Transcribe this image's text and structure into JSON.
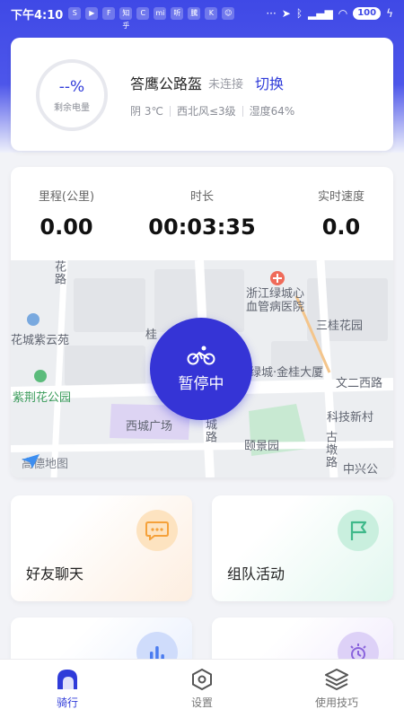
{
  "status_bar": {
    "time": "下午4:10",
    "apps": [
      "S",
      "▶",
      "F",
      "知乎",
      "C",
      "mi",
      "听",
      "騰",
      "K",
      "☺"
    ],
    "more": "···",
    "battery": "100"
  },
  "device": {
    "battery_value": "--%",
    "battery_label": "剩余电量",
    "name": "答鹰公路盔",
    "status": "未连接",
    "switch_label": "切换",
    "weather": {
      "condition": "阴 3℃",
      "wind": "西北风≤3级",
      "humidity": "湿度64%"
    }
  },
  "stats": {
    "distance_label": "里程(公里)",
    "distance_value": "0.00",
    "duration_label": "时长",
    "duration_value": "00:03:35",
    "speed_label": "实时速度",
    "speed_value": "0.0"
  },
  "map": {
    "labels": {
      "huajiao_road": "花路",
      "huacheng_ziyun": "花城紫云苑",
      "zijinghua_park": "紫荆花公园",
      "hospital": "浙江绿城心血管病医院",
      "sanguihuayuan": "三桂花园",
      "guihuayuan_partial": "桂",
      "jinguidasha": "绿城·金桂大厦",
      "wener_west_road": "文二西路",
      "tech_village": "科技新村",
      "xicheng_square": "西城广场",
      "chengroad": "城路",
      "yijingyuan": "颐景园",
      "gudun_road": "古墩路",
      "zhongxing": "中兴公"
    },
    "provider": "高德地图",
    "pause_label": "暂停中"
  },
  "features": {
    "chat": "好友聊天",
    "team": "组队活动",
    "stats_icon": "bar-chart-icon",
    "tips_icon": "bulb-icon"
  },
  "nav": {
    "ride": "骑行",
    "settings": "设置",
    "tips": "使用技巧"
  },
  "colors": {
    "primary": "#2f3bd9",
    "pause_button": "#3534d6",
    "header_gradient_top": "#3f49e6"
  }
}
